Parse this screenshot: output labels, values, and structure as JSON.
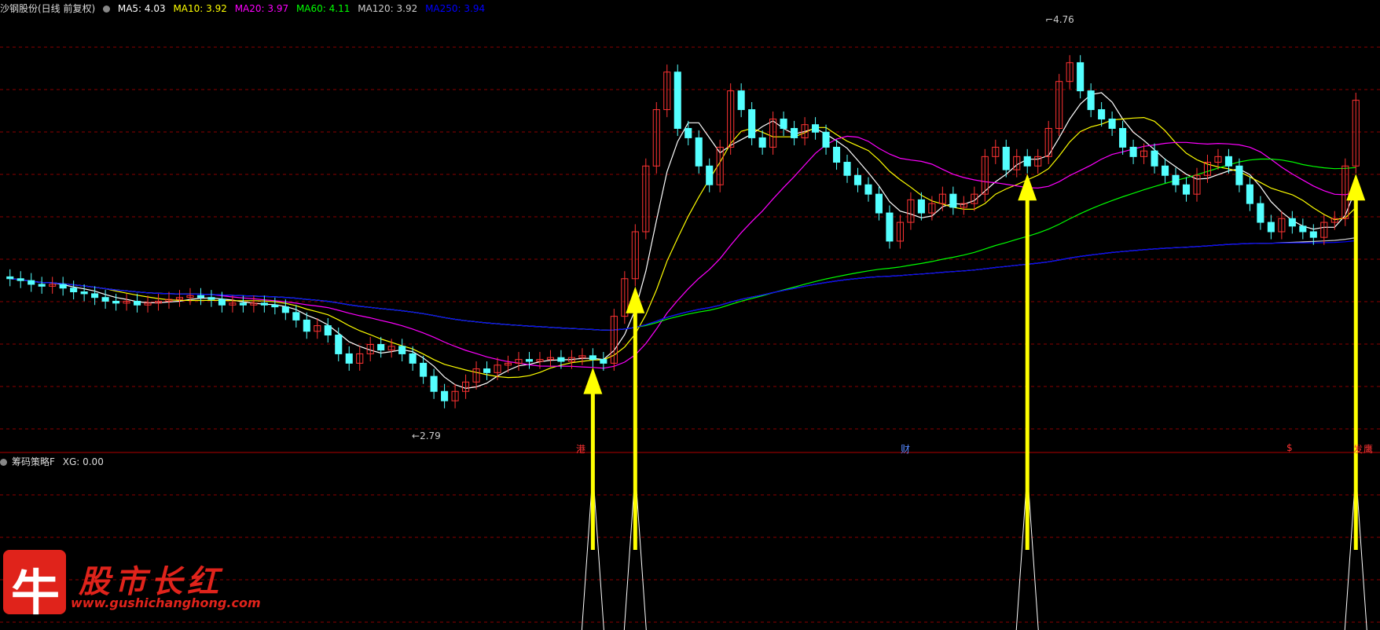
{
  "main_panel": {
    "title": "沙钢股份(日线 前复权)",
    "ma": [
      {
        "label": "MA5: 4.03",
        "color": "#ffffff"
      },
      {
        "label": "MA10: 3.92",
        "color": "#ffff00"
      },
      {
        "label": "MA20: 3.97",
        "color": "#ff00ff"
      },
      {
        "label": "MA60: 4.11",
        "color": "#00ff00"
      },
      {
        "label": "MA120: 3.92",
        "color": "#cccccc"
      },
      {
        "label": "MA250: 3.94",
        "color": "#0000ff"
      }
    ],
    "high_label": "4.76",
    "low_label": "2.79",
    "badges": [
      {
        "text": "港",
        "color": "#ff3333"
      },
      {
        "text": "财",
        "color": "#5588ff"
      },
      {
        "text": "$",
        "color": "#ff3333"
      },
      {
        "text": "发",
        "color": "#ff3333"
      },
      {
        "text": "鹰",
        "color": "#ff3333"
      }
    ]
  },
  "sub_panel": {
    "title": "筹码策略F",
    "value_label": "XG: 0.00"
  },
  "watermark": {
    "icon_char": "牛",
    "name": "股市长红",
    "url": "www.gushichanghong.com"
  },
  "colors": {
    "up": "#ff3333",
    "down": "#54ffff",
    "arrow": "#ffff00",
    "grid": "#8b0000",
    "divider": "#b00000"
  },
  "chart_data": {
    "type": "candlestick",
    "ylim": [
      2.6,
      4.9
    ],
    "candles_open_close": [
      [
        3.51,
        3.5
      ],
      [
        3.5,
        3.49
      ],
      [
        3.49,
        3.47
      ],
      [
        3.47,
        3.46
      ],
      [
        3.46,
        3.47
      ],
      [
        3.47,
        3.45
      ],
      [
        3.45,
        3.43
      ],
      [
        3.43,
        3.42
      ],
      [
        3.42,
        3.4
      ],
      [
        3.4,
        3.38
      ],
      [
        3.38,
        3.37
      ],
      [
        3.37,
        3.38
      ],
      [
        3.38,
        3.36
      ],
      [
        3.36,
        3.37
      ],
      [
        3.37,
        3.38
      ],
      [
        3.38,
        3.39
      ],
      [
        3.39,
        3.4
      ],
      [
        3.4,
        3.41
      ],
      [
        3.41,
        3.4
      ],
      [
        3.4,
        3.39
      ],
      [
        3.39,
        3.36
      ],
      [
        3.36,
        3.37
      ],
      [
        3.37,
        3.36
      ],
      [
        3.36,
        3.37
      ],
      [
        3.37,
        3.36
      ],
      [
        3.36,
        3.35
      ],
      [
        3.35,
        3.32
      ],
      [
        3.32,
        3.28
      ],
      [
        3.28,
        3.22
      ],
      [
        3.22,
        3.25
      ],
      [
        3.25,
        3.2
      ],
      [
        3.2,
        3.1
      ],
      [
        3.1,
        3.05
      ],
      [
        3.05,
        3.1
      ],
      [
        3.1,
        3.15
      ],
      [
        3.15,
        3.12
      ],
      [
        3.12,
        3.14
      ],
      [
        3.14,
        3.1
      ],
      [
        3.1,
        3.05
      ],
      [
        3.05,
        2.98
      ],
      [
        2.98,
        2.9
      ],
      [
        2.9,
        2.85
      ],
      [
        2.85,
        2.9
      ],
      [
        2.9,
        2.95
      ],
      [
        2.95,
        3.02
      ],
      [
        3.02,
        3.0
      ],
      [
        3.0,
        3.04
      ],
      [
        3.04,
        3.05
      ],
      [
        3.05,
        3.07
      ],
      [
        3.07,
        3.06
      ],
      [
        3.06,
        3.07
      ],
      [
        3.07,
        3.08
      ],
      [
        3.08,
        3.06
      ],
      [
        3.06,
        3.08
      ],
      [
        3.08,
        3.09
      ],
      [
        3.09,
        3.07
      ],
      [
        3.07,
        3.05
      ],
      [
        3.05,
        3.3
      ],
      [
        3.3,
        3.5
      ],
      [
        3.5,
        3.75
      ],
      [
        3.75,
        4.1
      ],
      [
        4.1,
        4.4
      ],
      [
        4.4,
        4.6
      ],
      [
        4.6,
        4.3
      ],
      [
        4.3,
        4.25
      ],
      [
        4.25,
        4.1
      ],
      [
        4.1,
        4.0
      ],
      [
        4.0,
        4.2
      ],
      [
        4.2,
        4.5
      ],
      [
        4.5,
        4.4
      ],
      [
        4.4,
        4.25
      ],
      [
        4.25,
        4.2
      ],
      [
        4.2,
        4.35
      ],
      [
        4.35,
        4.3
      ],
      [
        4.3,
        4.25
      ],
      [
        4.25,
        4.32
      ],
      [
        4.32,
        4.28
      ],
      [
        4.28,
        4.2
      ],
      [
        4.2,
        4.12
      ],
      [
        4.12,
        4.05
      ],
      [
        4.05,
        4.0
      ],
      [
        4.0,
        3.95
      ],
      [
        3.95,
        3.85
      ],
      [
        3.85,
        3.7
      ],
      [
        3.7,
        3.8
      ],
      [
        3.8,
        3.92
      ],
      [
        3.92,
        3.85
      ],
      [
        3.85,
        3.9
      ],
      [
        3.9,
        3.95
      ],
      [
        3.95,
        3.88
      ],
      [
        3.88,
        3.9
      ],
      [
        3.9,
        3.95
      ],
      [
        3.95,
        4.15
      ],
      [
        4.15,
        4.2
      ],
      [
        4.2,
        4.08
      ],
      [
        4.08,
        4.15
      ],
      [
        4.15,
        4.1
      ],
      [
        4.1,
        4.15
      ],
      [
        4.15,
        4.3
      ],
      [
        4.3,
        4.55
      ],
      [
        4.55,
        4.65
      ],
      [
        4.65,
        4.5
      ],
      [
        4.5,
        4.4
      ],
      [
        4.4,
        4.35
      ],
      [
        4.35,
        4.3
      ],
      [
        4.3,
        4.2
      ],
      [
        4.2,
        4.15
      ],
      [
        4.15,
        4.18
      ],
      [
        4.18,
        4.1
      ],
      [
        4.1,
        4.05
      ],
      [
        4.05,
        4.0
      ],
      [
        4.0,
        3.95
      ],
      [
        3.95,
        4.05
      ],
      [
        4.05,
        4.12
      ],
      [
        4.12,
        4.15
      ],
      [
        4.15,
        4.1
      ],
      [
        4.1,
        4.0
      ],
      [
        4.0,
        3.9
      ],
      [
        3.9,
        3.8
      ],
      [
        3.8,
        3.75
      ],
      [
        3.75,
        3.82
      ],
      [
        3.82,
        3.78
      ],
      [
        3.78,
        3.75
      ],
      [
        3.75,
        3.72
      ],
      [
        3.72,
        3.8
      ],
      [
        3.8,
        3.82
      ],
      [
        3.82,
        4.1
      ],
      [
        4.1,
        4.45
      ]
    ]
  }
}
